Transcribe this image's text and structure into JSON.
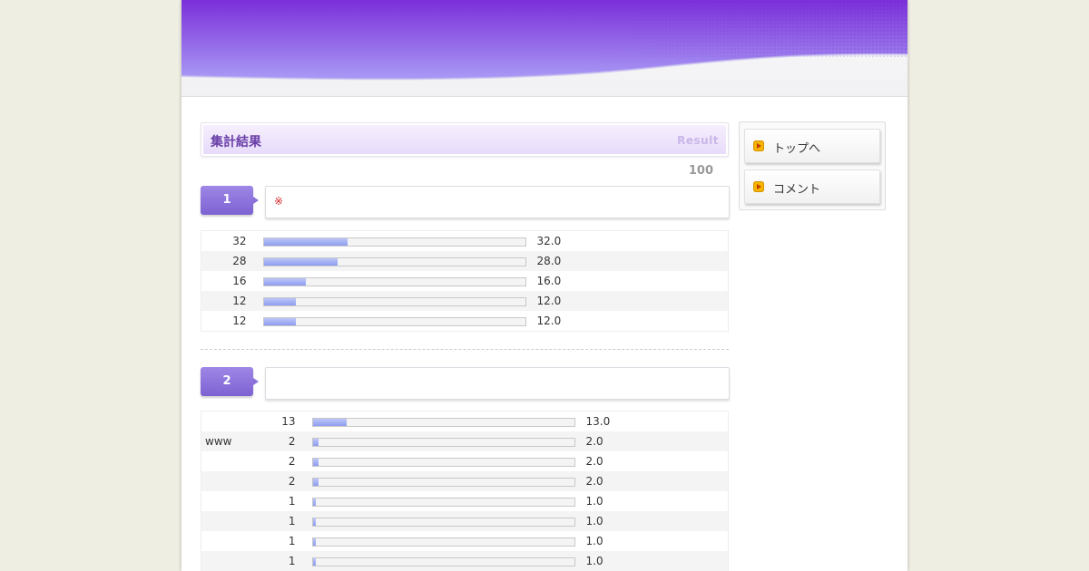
{
  "header": {
    "colors": {
      "top": "#7b2fd9",
      "bottom": "#a99af5"
    }
  },
  "result": {
    "title": "集計結果",
    "subtitle": "Result",
    "total": "100"
  },
  "questions": [
    {
      "number": "1",
      "text": "",
      "mark": "※",
      "rows": [
        {
          "label": "",
          "count": "32",
          "fill": 0.32,
          "percent": "32.0"
        },
        {
          "label": "",
          "count": "28",
          "fill": 0.28,
          "percent": "28.0"
        },
        {
          "label": "",
          "count": "16",
          "fill": 0.16,
          "percent": "16.0"
        },
        {
          "label": "",
          "count": "12",
          "fill": 0.12,
          "percent": "12.0"
        },
        {
          "label": "",
          "count": "12",
          "fill": 0.12,
          "percent": "12.0"
        }
      ]
    },
    {
      "number": "2",
      "text": "",
      "rows": [
        {
          "label": "",
          "count": "13",
          "fill": 0.13,
          "percent": "13.0"
        },
        {
          "label": "www",
          "count": "2",
          "fill": 0.02,
          "percent": "2.0"
        },
        {
          "label": "",
          "count": "2",
          "fill": 0.02,
          "percent": "2.0"
        },
        {
          "label": "",
          "count": "2",
          "fill": 0.02,
          "percent": "2.0"
        },
        {
          "label": "",
          "count": "1",
          "fill": 0.01,
          "percent": "1.0"
        },
        {
          "label": "",
          "count": "1",
          "fill": 0.01,
          "percent": "1.0"
        },
        {
          "label": "",
          "count": "1",
          "fill": 0.01,
          "percent": "1.0"
        },
        {
          "label": "",
          "count": "1",
          "fill": 0.01,
          "percent": "1.0"
        }
      ]
    }
  ],
  "sidebar": {
    "items": [
      {
        "label": "トップへ",
        "icon": "arrow-icon"
      },
      {
        "label": "コメント",
        "icon": "arrow-icon"
      }
    ]
  }
}
